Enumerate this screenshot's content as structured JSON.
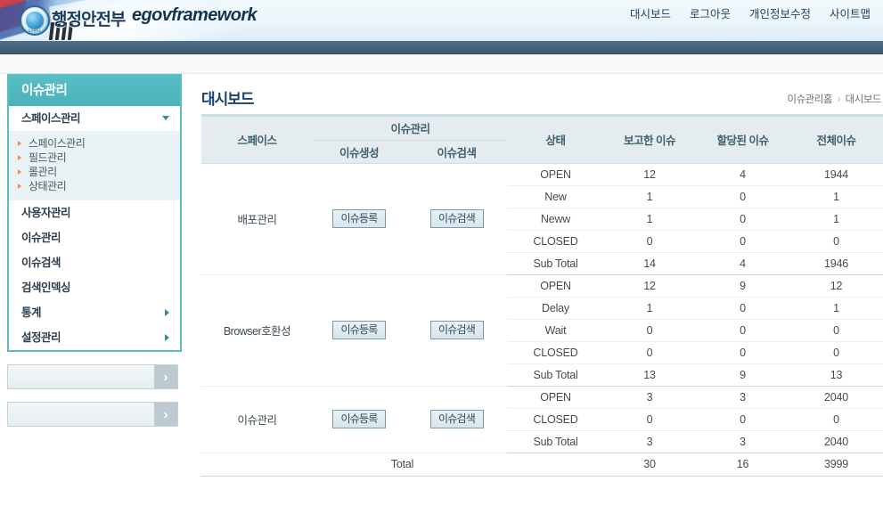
{
  "header": {
    "logo_kr": "행정안전부",
    "logo_en": "egovframework",
    "emblem_caption": "KOREA",
    "top_nav": [
      {
        "label": "대시보드"
      },
      {
        "label": "로그아웃"
      },
      {
        "label": "개인정보수정"
      },
      {
        "label": "사이트맵"
      }
    ]
  },
  "sidebar": {
    "title": "이슈관리",
    "menu": [
      {
        "label": "스페이스관리",
        "state": "expanded",
        "icon": "chevron-down-icon"
      },
      {
        "label": "사용자관리",
        "state": "plain",
        "icon": ""
      },
      {
        "label": "이슈관리",
        "state": "plain",
        "icon": ""
      },
      {
        "label": "이슈검색",
        "state": "plain",
        "icon": ""
      },
      {
        "label": "검색인덱싱",
        "state": "plain",
        "icon": ""
      },
      {
        "label": "통계",
        "state": "collapsed",
        "icon": "chevron-right-icon"
      },
      {
        "label": "설정관리",
        "state": "collapsed",
        "icon": "chevron-right-icon"
      }
    ],
    "submenu": [
      {
        "label": "스페이스관리"
      },
      {
        "label": "필드관리"
      },
      {
        "label": "롤관리"
      },
      {
        "label": "상태관리"
      }
    ],
    "banners": [
      {
        "label": "",
        "go": "›"
      },
      {
        "label": "",
        "go": "›"
      }
    ]
  },
  "main": {
    "page_title": "대시보드",
    "breadcrumb": {
      "home": "이슈관리홈",
      "separator": "›",
      "current": "대시보드"
    },
    "table": {
      "headers": {
        "space": "스페이스",
        "issue_mgmt": "이슈관리",
        "issue_create": "이슈생성",
        "issue_search": "이슈검색",
        "status": "상태",
        "reported": "보고한 이슈",
        "assigned": "할당된 이슈",
        "total": "전체이슈"
      },
      "buttons": {
        "register": "이슈등록",
        "search": "이슈검색"
      },
      "groups": [
        {
          "space": "배포관리",
          "rows": [
            {
              "status": "OPEN",
              "reported": "12",
              "assigned": "4",
              "total": "1944"
            },
            {
              "status": "New",
              "reported": "1",
              "assigned": "0",
              "total": "1"
            },
            {
              "status": "Neww",
              "reported": "1",
              "assigned": "0",
              "total": "1"
            },
            {
              "status": "CLOSED",
              "reported": "0",
              "assigned": "0",
              "total": "0"
            },
            {
              "status": "Sub Total",
              "reported": "14",
              "assigned": "4",
              "total": "1946"
            }
          ]
        },
        {
          "space": "Browser호환성",
          "rows": [
            {
              "status": "OPEN",
              "reported": "12",
              "assigned": "9",
              "total": "12"
            },
            {
              "status": "Delay",
              "reported": "1",
              "assigned": "0",
              "total": "1"
            },
            {
              "status": "Wait",
              "reported": "0",
              "assigned": "0",
              "total": "0"
            },
            {
              "status": "CLOSED",
              "reported": "0",
              "assigned": "0",
              "total": "0"
            },
            {
              "status": "Sub Total",
              "reported": "13",
              "assigned": "9",
              "total": "13"
            }
          ]
        },
        {
          "space": "이슈관리",
          "rows": [
            {
              "status": "OPEN",
              "reported": "3",
              "assigned": "3",
              "total": "2040"
            },
            {
              "status": "CLOSED",
              "reported": "0",
              "assigned": "0",
              "total": "0"
            },
            {
              "status": "Sub Total",
              "reported": "3",
              "assigned": "3",
              "total": "2040"
            }
          ]
        }
      ],
      "total_row": {
        "label": "Total",
        "reported": "30",
        "assigned": "16",
        "total": "3999"
      }
    }
  },
  "colors": {
    "teal": "#4bb2ba",
    "navbar": "#44627a",
    "title": "#16426b",
    "table_head": "#e5ecef",
    "bullet": "#ec8b4e"
  }
}
